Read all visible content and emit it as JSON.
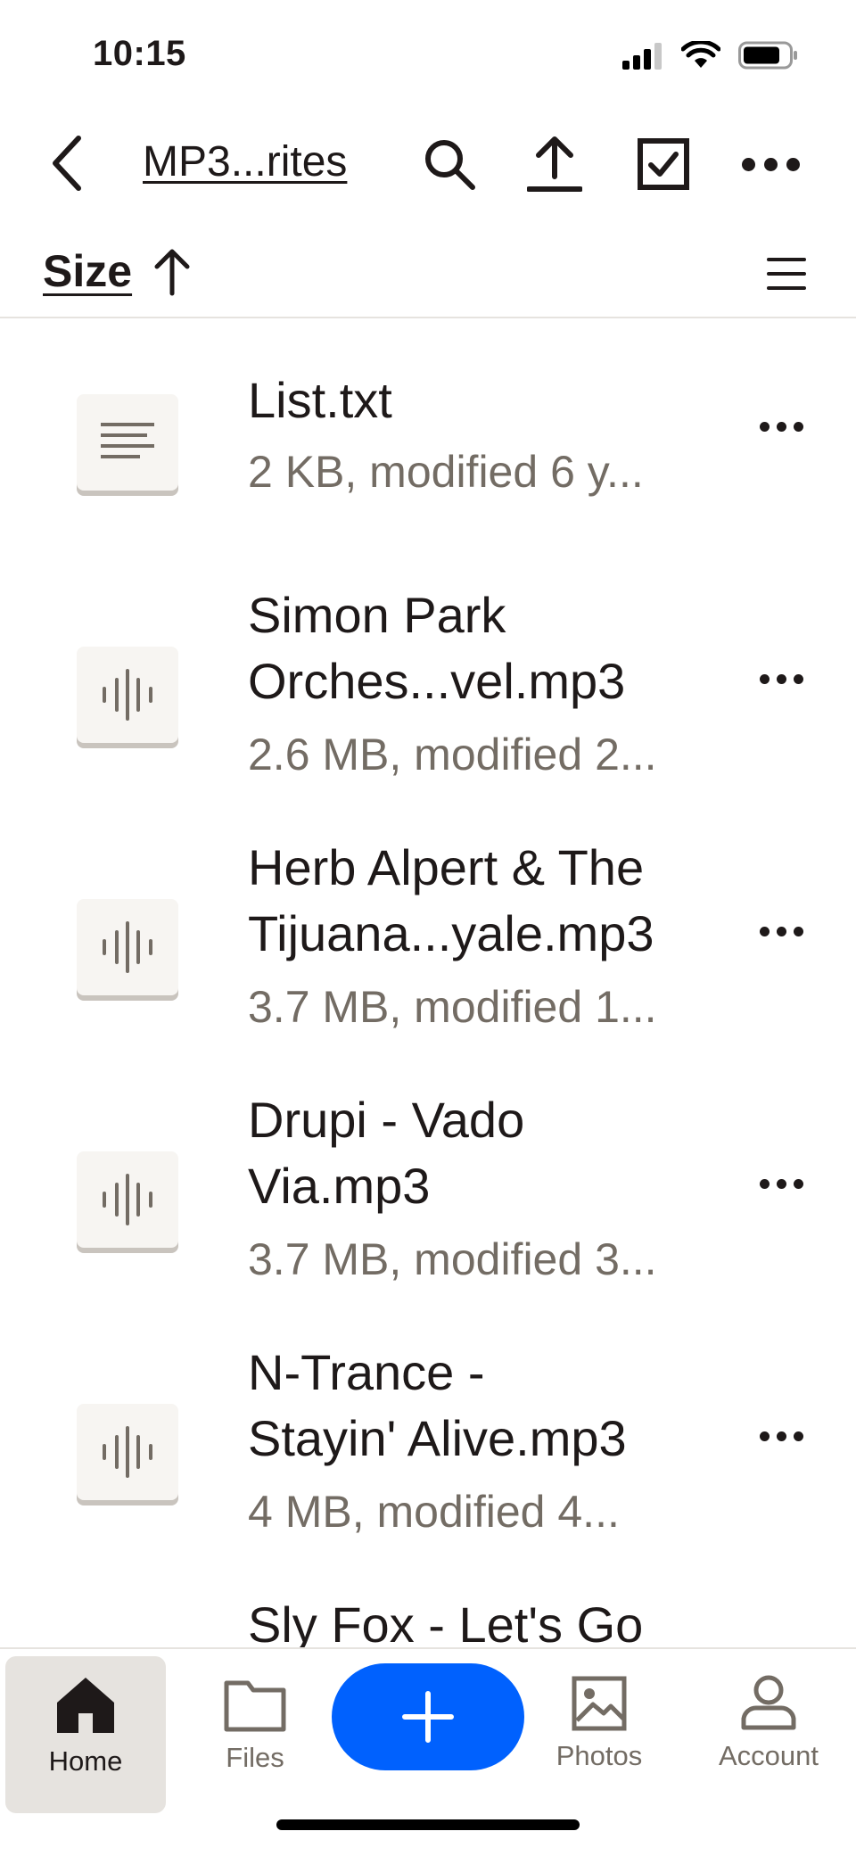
{
  "status_bar": {
    "time": "10:15"
  },
  "nav": {
    "title": "MP3...rites"
  },
  "sort": {
    "label": "Size"
  },
  "files": [
    {
      "name_line1": "List.txt",
      "name_line2": "",
      "meta": "2 KB, modified 6 y...",
      "type": "text"
    },
    {
      "name_line1": "Simon Park",
      "name_line2": "Orches...vel.mp3",
      "meta": "2.6 MB, modified 2...",
      "type": "audio"
    },
    {
      "name_line1": "Herb Alpert & The",
      "name_line2": "Tijuana...yale.mp3",
      "meta": "3.7 MB, modified 1...",
      "type": "audio"
    },
    {
      "name_line1": "Drupi - Vado",
      "name_line2": "Via.mp3",
      "meta": "3.7 MB, modified 3...",
      "type": "audio"
    },
    {
      "name_line1": "N-Trance -",
      "name_line2": "Stayin' Alive.mp3",
      "meta": "4 MB, modified 4...",
      "type": "audio"
    },
    {
      "name_line1": "Sly Fox - Let's Go",
      "name_line2": "",
      "meta": "",
      "type": "audio"
    }
  ],
  "tabs": [
    {
      "label": "Home",
      "icon": "home-icon",
      "active": true
    },
    {
      "label": "Files",
      "icon": "folder-icon",
      "active": false
    },
    {
      "label": "Photos",
      "icon": "photo-icon",
      "active": false
    },
    {
      "label": "Account",
      "icon": "person-icon",
      "active": false
    }
  ],
  "colors": {
    "accent": "#0061fe",
    "text": "#1e1919",
    "muted": "#736c64",
    "thumb_bg": "#f7f5f2"
  }
}
